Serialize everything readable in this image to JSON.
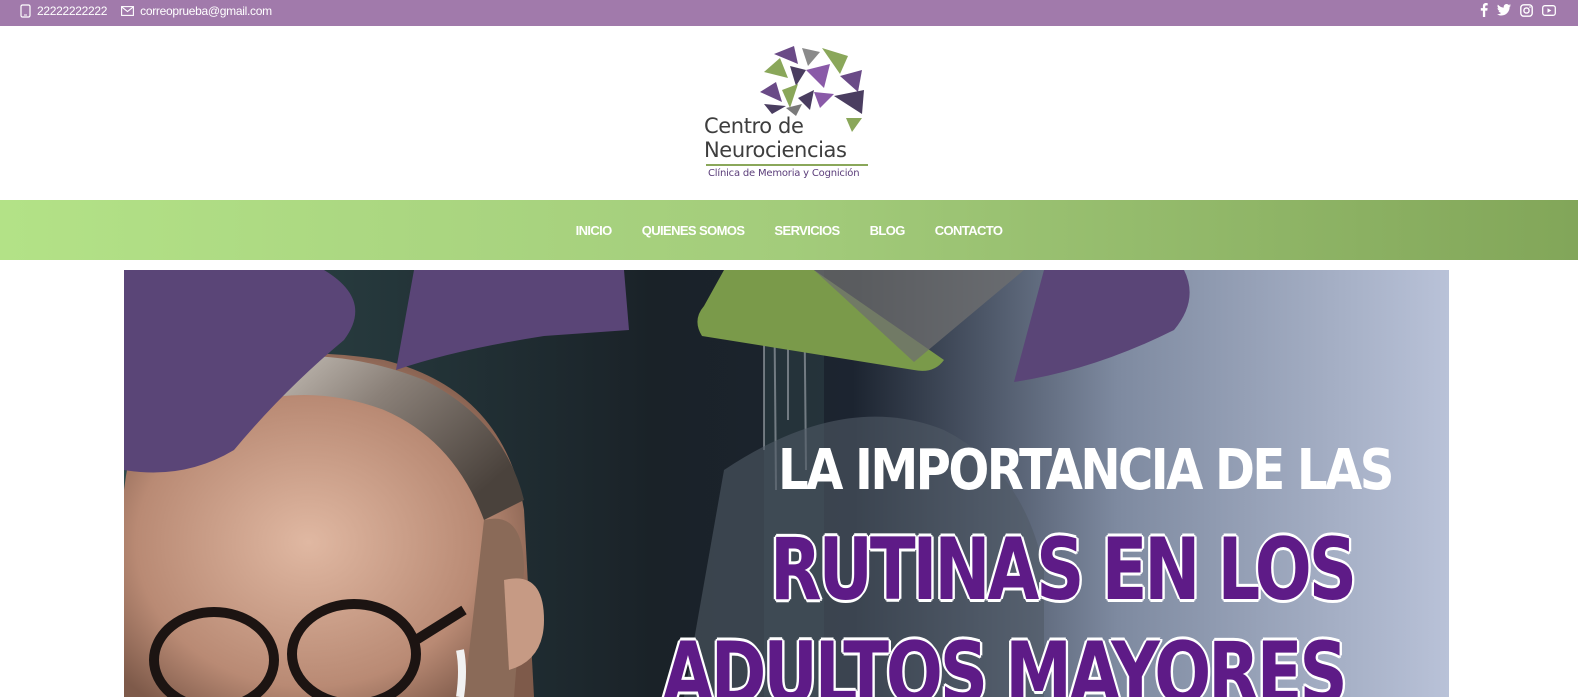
{
  "topbar": {
    "phone": "22222222222",
    "email": "correoprueba@gmail.com",
    "phone_icon": "phone-icon",
    "email_icon": "envelope-icon",
    "social": [
      "facebook-icon",
      "twitter-icon",
      "instagram-icon",
      "youtube-icon"
    ],
    "background": "#a17aab"
  },
  "logo": {
    "line1": "Centro de",
    "line2": "Neurociencias",
    "line3": "Clínica de Memoria y Cognición",
    "colors": {
      "purple": "#6a4a87",
      "green": "#8aa75a",
      "gray": "#4a4a4a"
    }
  },
  "nav": {
    "items": [
      "INICIO",
      "QUIENES SOMOS",
      "SERVICIOS",
      "BLOG",
      "CONTACTO"
    ],
    "gradient": [
      "#b3e287",
      "#82a659"
    ]
  },
  "hero": {
    "line1": "LA IMPORTANCIA DE LAS",
    "line2": "RUTINAS EN LOS",
    "line3": "ADULTOS MAYORES",
    "accent": "#5e1b87"
  }
}
